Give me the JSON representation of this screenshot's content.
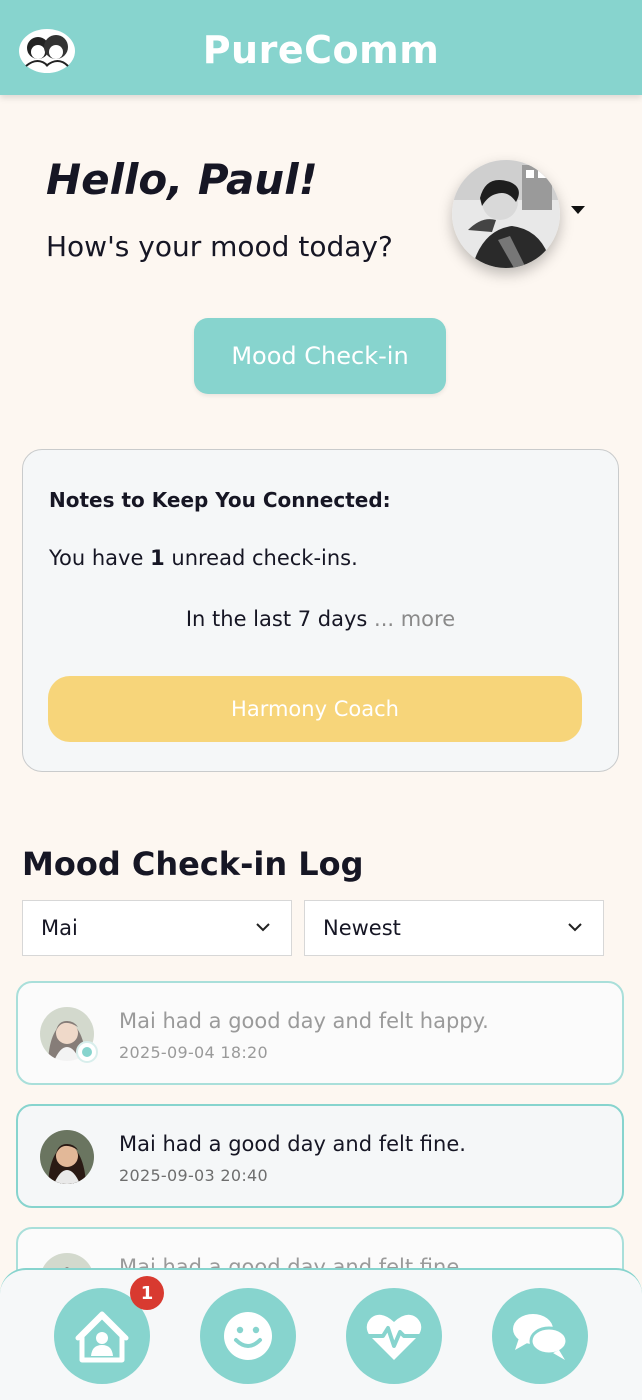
{
  "header": {
    "title": "PureComm",
    "logo_icon": "couple-logo-icon"
  },
  "greeting": {
    "title": "Hello, Paul!",
    "subtitle": "How's your mood today?",
    "profile_avatar": "profile-avatar"
  },
  "checkin_button": {
    "label": "Mood Check-in"
  },
  "notes": {
    "title": "Notes to Keep You Connected:",
    "unread_prefix": "You have ",
    "unread_count": "1",
    "unread_suffix": " unread check-ins.",
    "range_text": "In the last 7 days",
    "more_text": " ... more",
    "coach_button": "Harmony Coach"
  },
  "log": {
    "title": "Mood Check-in Log",
    "person_filter": "Mai",
    "sort_filter": "Newest",
    "entries": [
      {
        "text": "Mai had a good day and felt happy.",
        "time": "2025-09-04 18:20",
        "state": "read"
      },
      {
        "text": "Mai had a good day and felt fine.",
        "time": "2025-09-03 20:40",
        "state": "unread"
      },
      {
        "text": "Mai had a good day and felt fine."
      }
    ]
  },
  "bottom_nav": {
    "items": [
      "home",
      "mood",
      "health",
      "chat"
    ],
    "home_badge": "1"
  },
  "colors": {
    "accent": "#87d4ce",
    "coach": "#f7d57a",
    "background": "#fdf7f1",
    "badge": "#d83a30"
  }
}
